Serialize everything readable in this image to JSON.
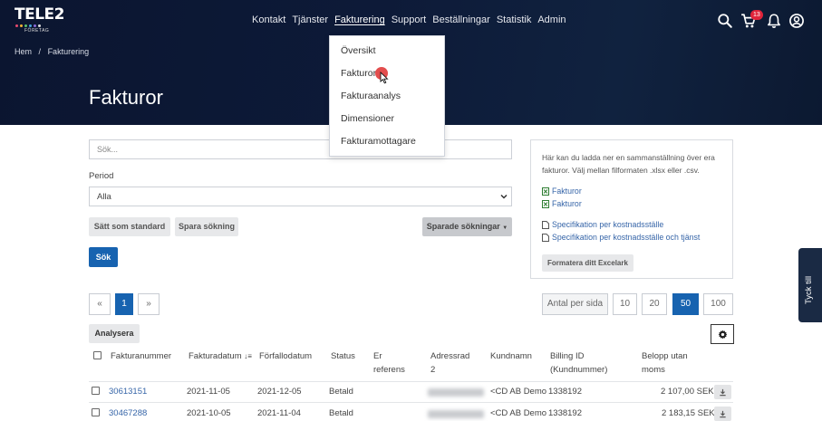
{
  "brand": {
    "logo_text": "TELE2",
    "logo_sub": "FÖRETAG",
    "dot_colors": [
      "#e94a6f",
      "#f1b434",
      "#5ac26b",
      "#47a6e0",
      "#8a6ad8",
      "#e0e0e0"
    ]
  },
  "nav": {
    "items": [
      {
        "label": "Kontakt"
      },
      {
        "label": "Tjänster"
      },
      {
        "label": "Fakturering"
      },
      {
        "label": "Support"
      },
      {
        "label": "Beställningar"
      },
      {
        "label": "Statistik"
      },
      {
        "label": "Admin"
      }
    ],
    "active": "Fakturering",
    "cart_count": "13"
  },
  "breadcrumb": {
    "home": "Hem",
    "sep": "/",
    "current": "Fakturering"
  },
  "page_title": "Fakturor",
  "dropdown": {
    "items": [
      "Översikt",
      "Fakturor",
      "Fakturaanalys",
      "Dimensioner",
      "Fakturamottagare"
    ]
  },
  "search": {
    "placeholder": "Sök...",
    "period_label": "Period",
    "period_value": "Alla",
    "btn_standard": "Sätt som standard",
    "btn_save": "Spara sökning",
    "btn_saved": "Sparade sökningar",
    "btn_search": "Sök"
  },
  "info_box": {
    "description": "Här kan du ladda ner en sammanställning över era fakturor. Välj mellan filformaten .xlsx eller .csv.",
    "excel_links": [
      "Fakturor",
      "Fakturor"
    ],
    "doc_links": [
      "Specifikation per kostnadsställe",
      "Specifikation per kostnadsställe och tjänst"
    ],
    "format_button": "Formatera ditt Excelark"
  },
  "pagination": {
    "prev": "«",
    "current": "1",
    "next": "»",
    "per_page_label": "Antal per sida",
    "sizes": [
      "10",
      "20",
      "50",
      "100"
    ],
    "selected_size": "50"
  },
  "table": {
    "analyse_button": "Analysera",
    "headers": {
      "invoice": "Fakturanummer",
      "date": "Fakturadatum",
      "due": "Förfallodatum",
      "status": "Status",
      "ref_1": "Er",
      "ref_2": "referens",
      "addr_1": "Adressrad",
      "addr_2": "2",
      "customer": "Kundnamn",
      "billing_1": "Billing ID",
      "billing_2": "(Kundnummer)",
      "amount_1": "Belopp utan",
      "amount_2": "moms"
    },
    "rows": [
      {
        "invoice": "30613151",
        "date": "2021-11-05",
        "due": "2021-12-05",
        "status": "Betald",
        "customer": "<CD AB Demo",
        "billing": "1338192",
        "amount": "2 107,00 SEK"
      },
      {
        "invoice": "30467288",
        "date": "2021-10-05",
        "due": "2021-11-04",
        "status": "Betald",
        "customer": "<CD AB Demo",
        "billing": "1338192",
        "amount": "2 183,15 SEK"
      }
    ]
  },
  "side_tab": {
    "label": "Tyck till"
  }
}
